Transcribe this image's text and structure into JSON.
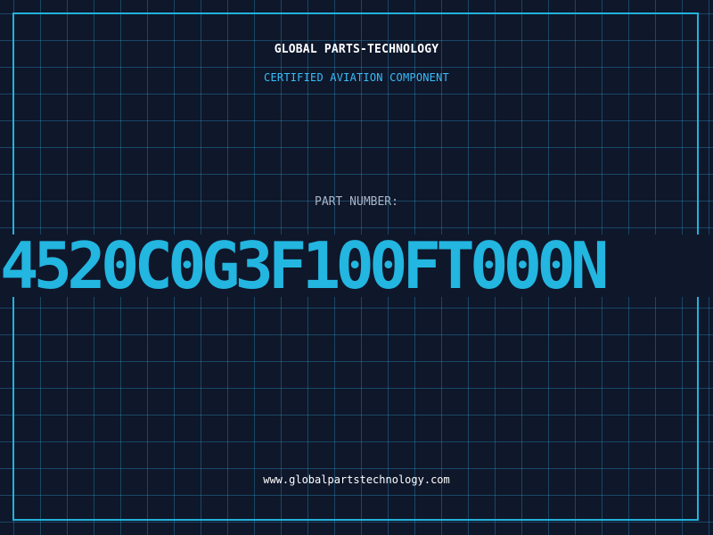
{
  "header": {
    "company": "GLOBAL PARTS-TECHNOLOGY",
    "subtitle": "CERTIFIED AVIATION COMPONENT"
  },
  "part": {
    "label": "PART NUMBER:",
    "number": "4520C0G3F100FT000N"
  },
  "footer": {
    "url": "www.globalpartstechnology.com"
  },
  "colors": {
    "background": "#0f172b",
    "accent": "#22b2dc",
    "grid": "#38bdf8",
    "label": "#a8b4c6",
    "text": "#ffffff"
  }
}
